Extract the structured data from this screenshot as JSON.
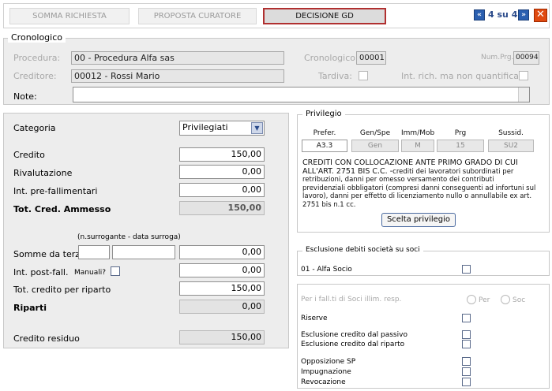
{
  "tabs": [
    {
      "label": "SOMMA RICHIESTA"
    },
    {
      "label": "PROPOSTA CURATORE"
    },
    {
      "label": "DECISIONE GD"
    }
  ],
  "nav": {
    "prev": "«",
    "page_text": "4 su 4",
    "next": "»",
    "close": "✕"
  },
  "cronologico": {
    "legend": "Cronologico",
    "procedura_label": "Procedura:",
    "procedura_value": "00 - Procedura Alfa sas",
    "creditore_label": "Creditore:",
    "creditore_value": "00012 - Rossi Mario",
    "cronologico_label": "Cronologico:",
    "cronologico_value": "00001",
    "numprg_label": "Num.Prg.",
    "numprg_value": "00094",
    "tardiva_label": "Tardiva:",
    "int_label": "Int. rich. ma non quantificati:",
    "note_label": "Note:",
    "note_value": ""
  },
  "left": {
    "categoria_label": "Categoria",
    "categoria_value": "Privilegiati",
    "credito_label": "Credito",
    "credito_value": "150,00",
    "rivalutazione_label": "Rivalutazione",
    "rivalutazione_value": "0,00",
    "intpre_label": "Int. pre-fallimentari",
    "intpre_value": "0,00",
    "totcred_label": "Tot. Cred. Ammesso",
    "totcred_value": "150,00",
    "surroga_hint": "(n.surrogante - data surroga)",
    "somme_label": "Somme da terzi",
    "somme_value": "0,00",
    "intpost_label": "Int. post-fall.",
    "manuali_label": "Manuali?",
    "intpost_value": "0,00",
    "totriparto_label": "Tot. credito per riparto",
    "totriparto_value": "150,00",
    "riparti_label": "Riparti",
    "riparti_value": "0,00",
    "residuo_label": "Credito residuo",
    "residuo_value": "150,00"
  },
  "privilegio": {
    "legend": "Privilegio",
    "headers": [
      "Prefer.",
      "Gen/Spe",
      "Imm/Mob",
      "Prg",
      "Sussid."
    ],
    "values": [
      "A3.3",
      "Gen",
      "M",
      "15",
      "SU2"
    ],
    "title_text": "CREDITI CON COLLOCAZIONE ANTE PRIMO GRADO DI CUI ALL'ART. 2751 BIS C.C. -",
    "body_text": "crediti dei lavoratori subordinati per retribuzioni, danni per omesso versamento dei contributi previdenziali obbligatori (compresi danni conseguenti ad infortuni sul lavoro), danni per effetto di licenziamento nullo o annullabile ex art. 2751 bis n.1 cc.",
    "button": "Scelta privilegio"
  },
  "esclusione": {
    "legend": "Esclusione debiti società su soci",
    "socio": "01 - Alfa Socio"
  },
  "options": {
    "falliti_label": "Per i fall.ti di Soci illim. resp.",
    "radio_per": "Per",
    "radio_soc": "Soc",
    "riserve": "Riserve",
    "escl_passivo": "Esclusione credito dal passivo",
    "escl_riparto": "Esclusione credito dal riparto",
    "opposizione": "Opposizione SP",
    "impugnazione": "Impugnazione",
    "revocazione": "Revocazione"
  }
}
